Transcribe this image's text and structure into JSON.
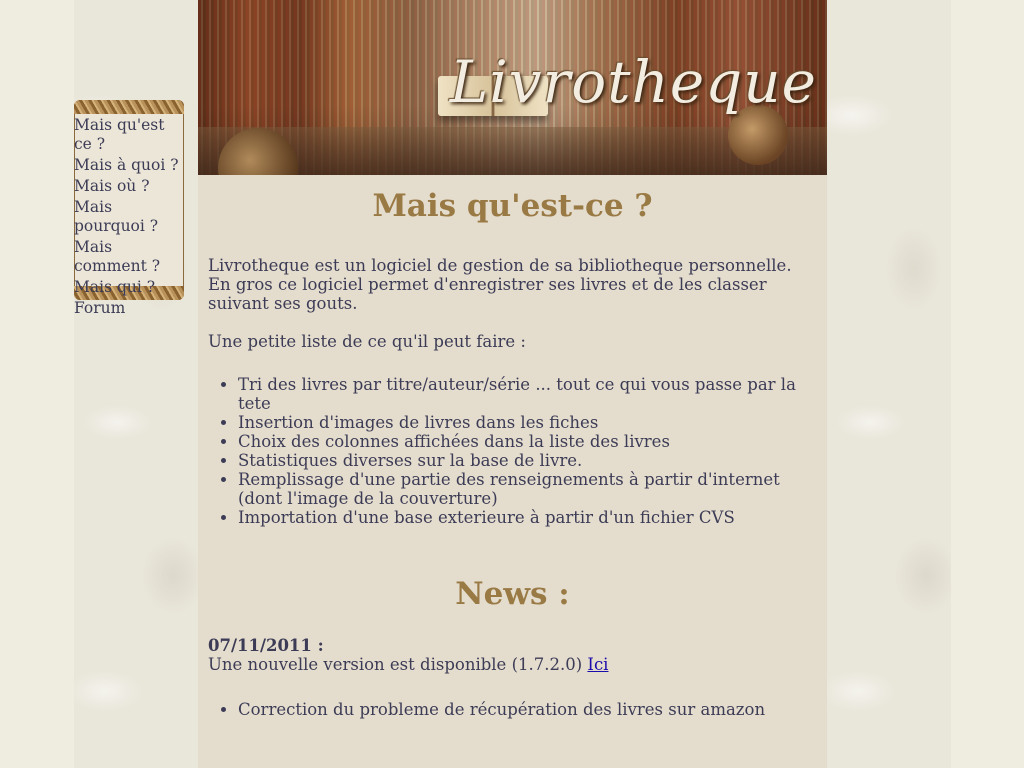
{
  "site_title": "Livrotheque",
  "menu": [
    {
      "label": "Mais qu'est ce ?"
    },
    {
      "label": "Mais à quoi ?"
    },
    {
      "label": "Mais où ?"
    },
    {
      "label": "Mais pourquoi ?"
    },
    {
      "label": "Mais comment ?"
    },
    {
      "label": "Mais qui ?"
    },
    {
      "label": "Forum"
    }
  ],
  "intro_section": {
    "heading": "Mais qu'est-ce ?",
    "paragraph": "Livrotheque est un logiciel de gestion de sa bibliotheque personnelle. En gros ce logiciel permet d'enregistrer ses livres et de les classer suivant ses gouts.",
    "list_intro": "Une petite liste de ce qu'il peut faire :",
    "features": [
      "Tri des livres par titre/auteur/série ... tout ce qui vous passe par la tete",
      "Insertion d'images de livres dans les fiches",
      "Choix des colonnes affichées dans la liste des livres",
      "Statistiques diverses sur la base de livre.",
      "Remplissage d'une partie des renseignements à partir d'internet (dont l'image de la couverture)",
      "Importation d'une base exterieure à partir d'un fichier CVS"
    ]
  },
  "news_section": {
    "heading": "News :",
    "entries": [
      {
        "date": "07/11/2011 :",
        "text": "Une nouvelle version est disponible (1.7.2.0)",
        "link_label": "Ici",
        "items": [
          "Correction du probleme de récupération des livres sur amazon"
        ]
      }
    ]
  }
}
